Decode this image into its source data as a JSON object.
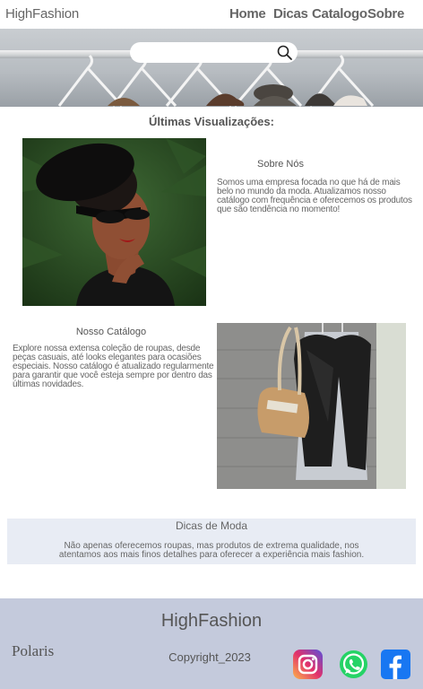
{
  "nav": {
    "brand": "HighFashion",
    "links": [
      "Home",
      "Dicas",
      "Catalogo",
      "Sobre"
    ]
  },
  "search": {
    "placeholder": "",
    "icon": "search-icon"
  },
  "recent": {
    "title": "Últimas Visualizações:"
  },
  "about": {
    "heading": "Sobre Nós",
    "text": "Somos uma empresa focada no que há de mais belo no mundo da moda. Atualizamos nosso catálogo com frequência e oferecemos os produtos que são tendência no momento!"
  },
  "catalog": {
    "heading": "Nosso Catálogo",
    "text": "Explore nossa extensa coleção de roupas, desde peças casuais, até looks elegantes para ocasiões especiais. Nosso catálogo é atualizado regularmente para garantir que você  esteja sempre por dentro das últimas novidades."
  },
  "tips": {
    "heading": "Dicas de Moda",
    "text": "Não apenas oferecemos roupas, mas produtos de extrema qualidade, nos atentamos aos mais finos detalhes para oferecer a experiência mais fashion."
  },
  "footer": {
    "brand": "HighFashion",
    "partner": "Polaris",
    "copyright": "Copyright_2023",
    "social": [
      "instagram-icon",
      "whatsapp-icon",
      "facebook-icon"
    ]
  },
  "colors": {
    "footer_bg": "#c4cadc",
    "tips_bg": "#e8ecf4",
    "text": "#555555"
  }
}
